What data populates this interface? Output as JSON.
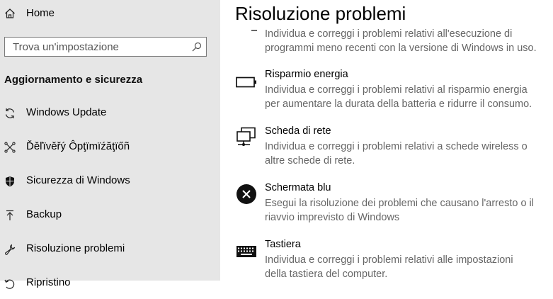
{
  "sidebar": {
    "home_label": "Home",
    "search_placeholder": "Trova un'impostazione",
    "section_title": "Aggiornamento e sicurezza",
    "items": [
      {
        "label": "Windows Update",
        "icon": "refresh-icon"
      },
      {
        "label": "Ďěľïvěřý Ôpţïmïźăţïőñ",
        "icon": "delivery-optimization-icon"
      },
      {
        "label": "Sicurezza di Windows",
        "icon": "shield-icon"
      },
      {
        "label": "Backup",
        "icon": "backup-arrow-icon"
      },
      {
        "label": "Risoluzione problemi",
        "icon": "wrench-icon"
      },
      {
        "label": "Ripristino",
        "icon": "recovery-icon"
      }
    ]
  },
  "main": {
    "title": "Risoluzione problemi",
    "items": [
      {
        "name": "",
        "icon": "compatibility-icon",
        "desc_lines": [
          "Individua e correggi i problemi relativi all'esecuzione di",
          "programmi meno recenti con la versione di Windows in uso."
        ]
      },
      {
        "name": "Risparmio energia",
        "icon": "battery-icon",
        "desc_lines": [
          "Individua e correggi i problemi relativi al risparmio energia",
          "per aumentare la durata della batteria e ridurre il consumo."
        ]
      },
      {
        "name": "Scheda di rete",
        "icon": "network-adapter-icon",
        "desc_lines": [
          "Individua e correggi i problemi relativi a schede wireless o",
          "altre schede di rete."
        ]
      },
      {
        "name": "Schermata blu",
        "icon": "blue-screen-error-icon",
        "desc_lines": [
          "Esegui la risoluzione dei problemi che causano l'arresto o il",
          "riavvio imprevisto di Windows"
        ]
      },
      {
        "name": "Tastiera",
        "icon": "keyboard-icon",
        "desc_lines": [
          "Individua e correggi i problemi relativi alle impostazioni",
          "della tastiera del computer."
        ]
      }
    ]
  }
}
